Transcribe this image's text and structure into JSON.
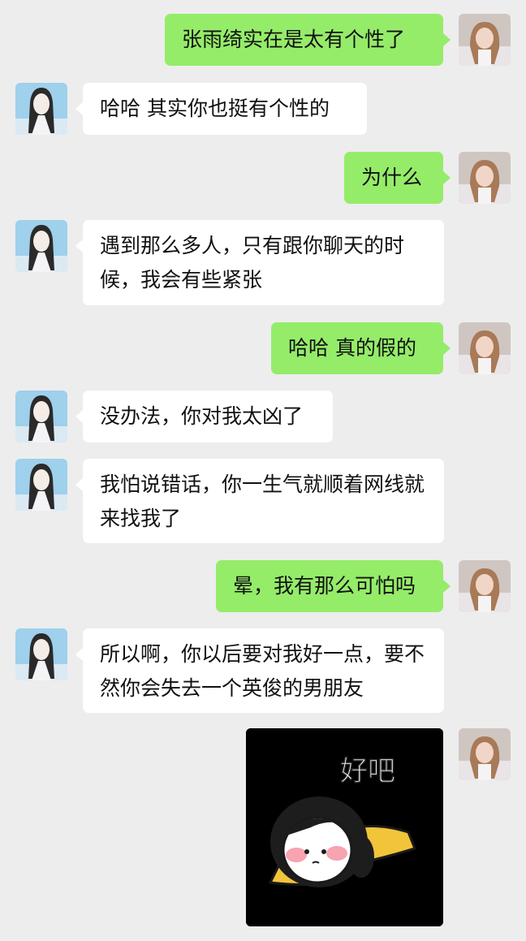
{
  "messages": [
    {
      "from": "me",
      "text": "张雨绮实在是太有个性了"
    },
    {
      "from": "peer",
      "text": "哈哈 其实你也挺有个性的"
    },
    {
      "from": "me",
      "text": "为什么"
    },
    {
      "from": "peer",
      "text": "遇到那么多人，只有跟你聊天的时候，我会有些紧张"
    },
    {
      "from": "me",
      "text": "哈哈 真的假的"
    },
    {
      "from": "peer",
      "text": "没办法，你对我太凶了"
    },
    {
      "from": "peer",
      "text": "我怕说错话，你一生气就顺着网线就来找我了"
    },
    {
      "from": "me",
      "text": "晕，我有那么可怕吗"
    },
    {
      "from": "peer",
      "text": "所以啊，你以后要对我好一点，要不然你会失去一个英俊的男朋友"
    }
  ],
  "sticker": {
    "text": "好吧"
  },
  "colors": {
    "background": "#ededed",
    "me_bubble": "#95ec69",
    "peer_bubble": "#ffffff"
  }
}
